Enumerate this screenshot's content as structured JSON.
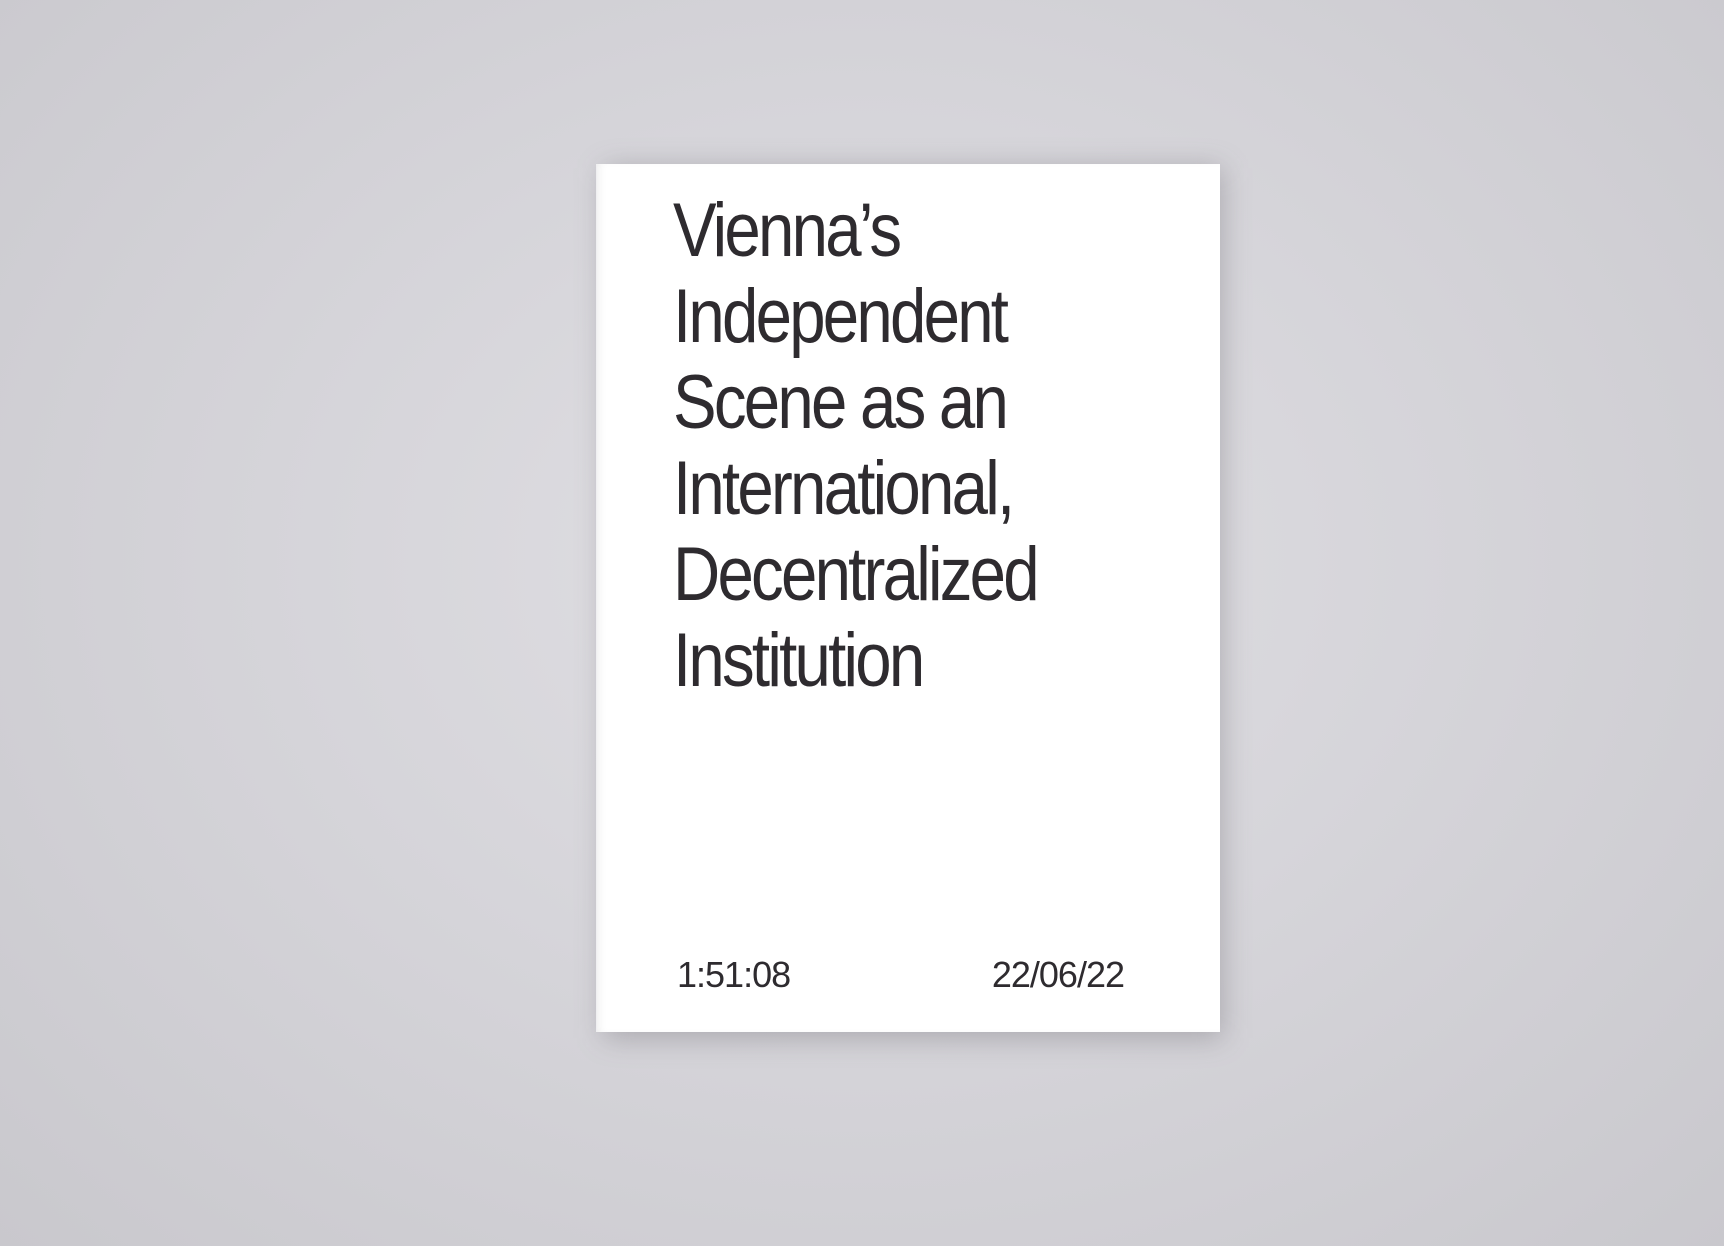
{
  "book": {
    "title_lines": [
      "Vienna’s",
      "Independent",
      "Scene as an",
      "International,",
      "Decentralized",
      "Institution"
    ],
    "duration": "1:51:08",
    "date": "22/06/22"
  },
  "colors": {
    "background": "#d6d5da",
    "cover": "#ffffff",
    "text": "#2e2b2f",
    "spine_edge": "#1e1d22"
  }
}
